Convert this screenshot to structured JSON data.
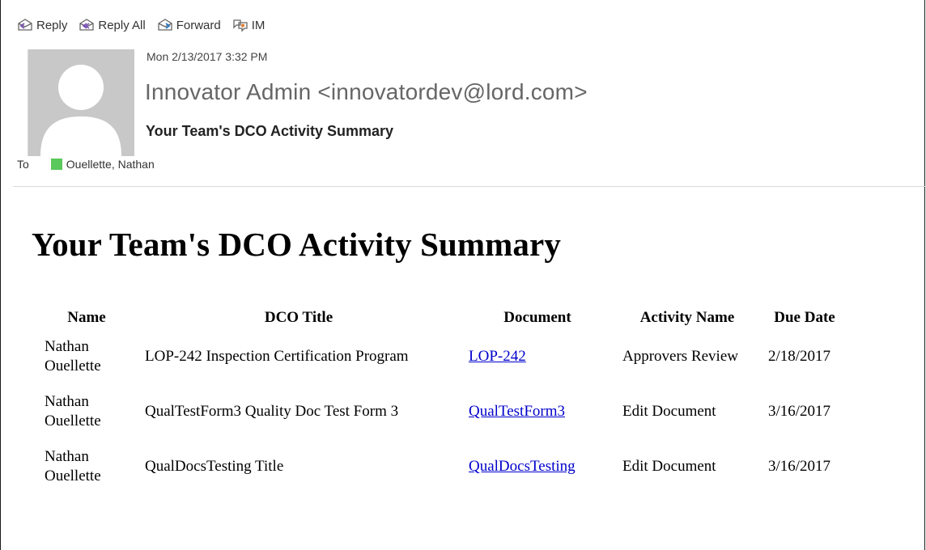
{
  "toolbar": {
    "reply": "Reply",
    "reply_all": "Reply All",
    "forward": "Forward",
    "im": "IM"
  },
  "message": {
    "date": "Mon 2/13/2017 3:32 PM",
    "sender": "Innovator Admin <innovatordev@lord.com>",
    "subject": "Your Team's DCO Activity Summary",
    "to_label": "To",
    "recipient": "Ouellette, Nathan",
    "presence_color": "#5ac85a"
  },
  "body": {
    "title": "Your Team's DCO Activity Summary",
    "columns": [
      "Name",
      "DCO Title",
      "Document",
      "Activity Name",
      "Due Date"
    ],
    "rows": [
      {
        "name": "Nathan Ouellette",
        "dco_title": "LOP-242 Inspection Certification Program",
        "document": "LOP-242",
        "activity": "Approvers Review",
        "due": "2/18/2017"
      },
      {
        "name": "Nathan Ouellette",
        "dco_title": "QualTestForm3 Quality Doc Test Form 3",
        "document": "QualTestForm3",
        "activity": "Edit Document",
        "due": "3/16/2017"
      },
      {
        "name": "Nathan Ouellette",
        "dco_title": "QualDocsTesting Title",
        "document": "QualDocsTesting",
        "activity": "Edit Document",
        "due": "3/16/2017"
      }
    ]
  },
  "colors": {
    "link": "#0000cc",
    "avatar_bg": "#c8c8c8",
    "icon_accent": "#7a4fb5"
  }
}
